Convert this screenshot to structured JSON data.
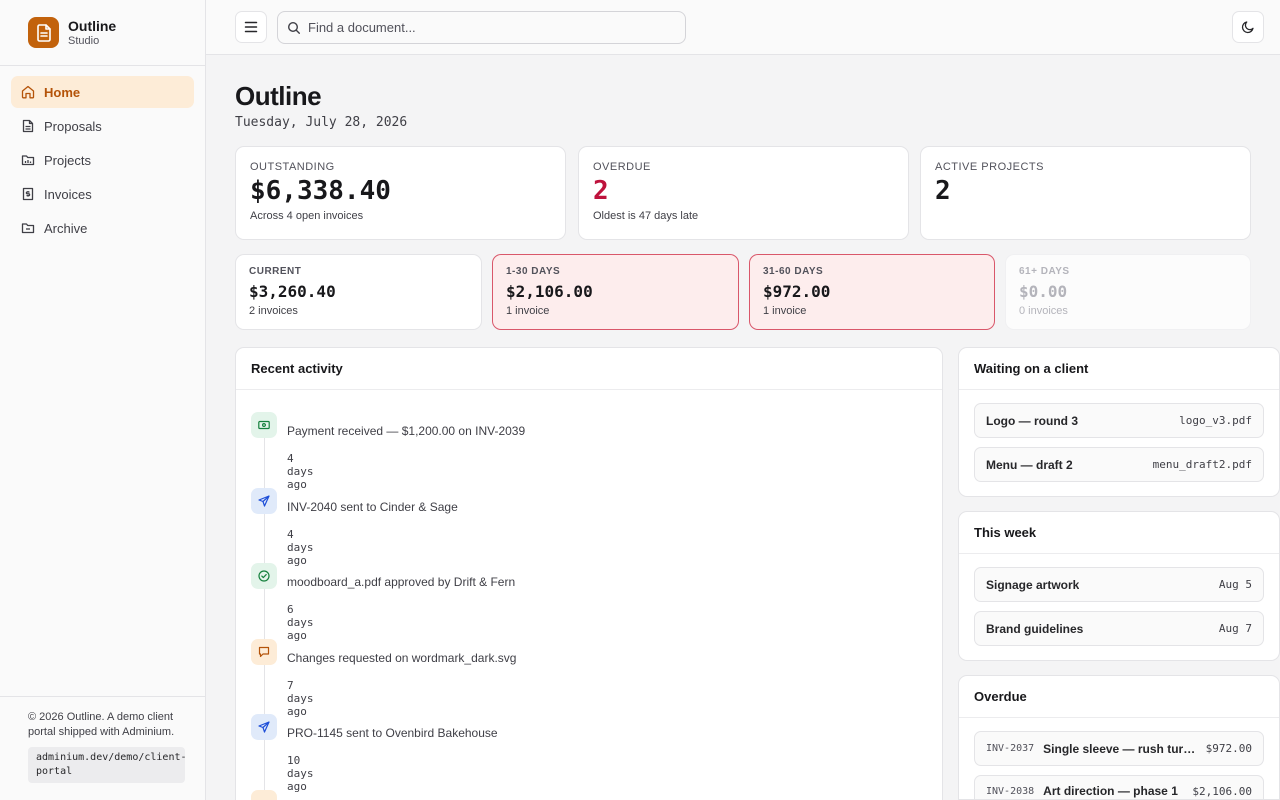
{
  "brand": {
    "name": "Outline",
    "sub": "Studio"
  },
  "nav": [
    {
      "label": "Home",
      "icon": "home-icon",
      "active": true
    },
    {
      "label": "Proposals",
      "icon": "document-icon"
    },
    {
      "label": "Projects",
      "icon": "folder-icon"
    },
    {
      "label": "Invoices",
      "icon": "dollar-receipt-icon"
    },
    {
      "label": "Archive",
      "icon": "archive-icon"
    }
  ],
  "footer": {
    "text": "© 2026 Outline. A demo client portal shipped with Adminium.",
    "code": "adminium.dev/demo/client-portal"
  },
  "topbar": {
    "search_placeholder": "Find a document..."
  },
  "page": {
    "title": "Outline",
    "date": "Tuesday, July 28, 2026"
  },
  "stats": [
    {
      "label": "OUTSTANDING",
      "value": "$6,338.40",
      "sub": "Across 4 open invoices"
    },
    {
      "label": "OVERDUE",
      "value": "2",
      "sub": "Oldest is 47 days late"
    },
    {
      "label": "ACTIVE PROJECTS",
      "value": "2",
      "sub": ""
    }
  ],
  "aging": [
    {
      "label": "CURRENT",
      "value": "$3,260.40",
      "sub": "2 invoices"
    },
    {
      "label": "1-30 DAYS",
      "value": "$2,106.00",
      "sub": "1 invoice"
    },
    {
      "label": "31-60 DAYS",
      "value": "$972.00",
      "sub": "1 invoice"
    },
    {
      "label": "61+ DAYS",
      "value": "$0.00",
      "sub": "0 invoices"
    }
  ],
  "activity": {
    "title": "Recent activity",
    "items": [
      {
        "text": "Payment received — $1,200.00 on INV-2039",
        "time": "4 days ago",
        "icon": "cash-icon"
      },
      {
        "text": "INV-2040 sent to Cinder & Sage",
        "time": "4 days ago",
        "icon": "send-icon"
      },
      {
        "text": "moodboard_a.pdf approved by Drift & Fern",
        "time": "6 days ago",
        "icon": "check-circle-icon"
      },
      {
        "text": "Changes requested on wordmark_dark.svg",
        "time": "7 days ago",
        "icon": "comment-icon"
      },
      {
        "text": "PRO-1145 sent to Ovenbird Bakehouse",
        "time": "10 days ago",
        "icon": "send-icon"
      }
    ]
  },
  "waiting": {
    "title": "Waiting on a client",
    "items": [
      {
        "name": "Logo — round 3",
        "file": "logo_v3.pdf"
      },
      {
        "name": "Menu — draft 2",
        "file": "menu_draft2.pdf"
      }
    ]
  },
  "week": {
    "title": "This week",
    "items": [
      {
        "name": "Signage artwork",
        "date": "Aug 5"
      },
      {
        "name": "Brand guidelines",
        "date": "Aug 7"
      }
    ]
  },
  "overdue": {
    "title": "Overdue",
    "items": [
      {
        "code": "INV-2037",
        "name": "Single sleeve — rush turnaround",
        "amount": "$972.00"
      },
      {
        "code": "INV-2038",
        "name": "Art direction — phase 1",
        "amount": "$2,106.00"
      }
    ]
  },
  "colors": {
    "accent": "#c2620c",
    "danger": "#be123c",
    "warn_bg": "#fdeded"
  }
}
